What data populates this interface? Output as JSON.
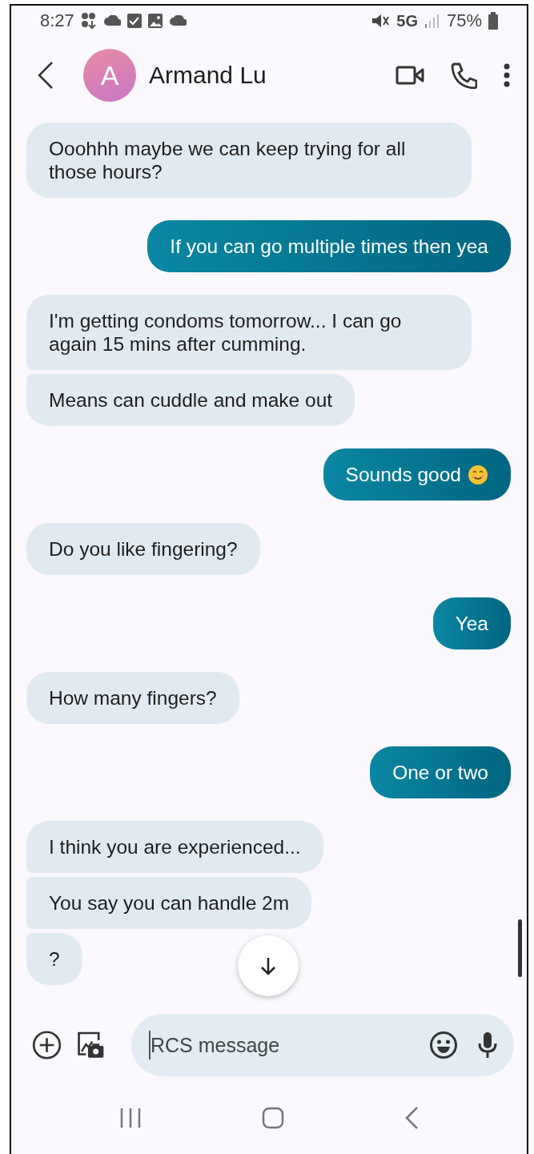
{
  "status_bar": {
    "time": "8:27",
    "network": "5G",
    "battery": "75%"
  },
  "header": {
    "avatar_letter": "A",
    "contact_name": "Armand Lu"
  },
  "messages": [
    {
      "kind": "received",
      "text": "Ooohhh maybe we can keep trying for all those hours?"
    },
    {
      "kind": "sent",
      "text": "If you can go multiple times then yea"
    },
    {
      "kind": "received",
      "text": "I'm getting condoms tomorrow... I can go again 15 mins after cumming."
    },
    {
      "kind": "received",
      "text": "Means can cuddle and make out"
    },
    {
      "kind": "sent",
      "text": "Sounds good",
      "emoji": true
    },
    {
      "kind": "received",
      "text": "Do you like fingering?"
    },
    {
      "kind": "sent",
      "text": "Yea"
    },
    {
      "kind": "received",
      "text": "How many fingers?"
    },
    {
      "kind": "sent",
      "text": "One or two"
    },
    {
      "kind": "received",
      "text": "I think you are experienced..."
    },
    {
      "kind": "received",
      "text": "You say you can handle 2m"
    },
    {
      "kind": "received",
      "text": "?"
    }
  ],
  "composer": {
    "placeholder": "RCS message"
  }
}
